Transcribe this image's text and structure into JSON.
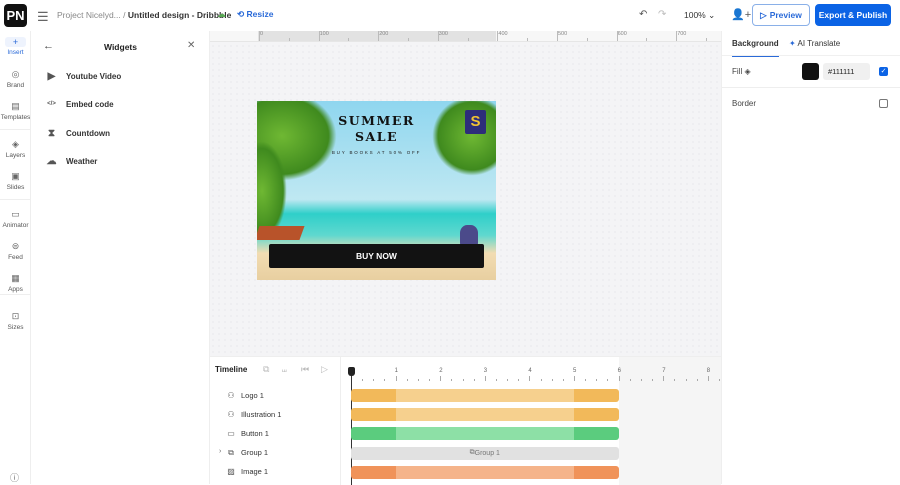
{
  "header": {
    "logo": "PN",
    "project": "Project Nicelyd...",
    "separator": "/",
    "design_name": "Untitled design - Dribbble",
    "resize_label": "Resize",
    "zoom": "100%",
    "preview_label": "Preview",
    "export_label": "Export & Publish"
  },
  "rail": [
    {
      "label": "Insert",
      "icon": "plus-icon"
    },
    {
      "label": "Brand",
      "icon": "brand-icon"
    },
    {
      "label": "Templates",
      "icon": "templates-icon"
    },
    {
      "label": "Layers",
      "icon": "layers-icon"
    },
    {
      "label": "Slides",
      "icon": "slides-icon"
    },
    {
      "label": "Animator",
      "icon": "animator-icon"
    },
    {
      "label": "Feed",
      "icon": "feed-icon"
    },
    {
      "label": "Apps",
      "icon": "apps-icon"
    },
    {
      "label": "Sizes",
      "icon": "sizes-icon"
    }
  ],
  "widgets": {
    "title": "Widgets",
    "items": [
      {
        "label": "Youtube Video",
        "icon": "video-icon"
      },
      {
        "label": "Embed code",
        "icon": "code-icon"
      },
      {
        "label": "Countdown",
        "icon": "hourglass-icon"
      },
      {
        "label": "Weather",
        "icon": "weather-icon"
      }
    ]
  },
  "ruler": {
    "labels": [
      "0",
      "100",
      "200",
      "300",
      "400",
      "500",
      "600",
      "700"
    ]
  },
  "design": {
    "title1": "SUMMER",
    "title2": "SALE",
    "subtitle": "BUY BOOKS AT 50% OFF",
    "button": "BUY NOW",
    "bag_letter": "S"
  },
  "timeline": {
    "title": "Timeline",
    "seconds": [
      "1",
      "2",
      "3",
      "4",
      "5",
      "6",
      "7",
      "8"
    ],
    "duration": 6,
    "in_end": 1,
    "out_start": 5,
    "rows": [
      {
        "name": "Logo 1",
        "icon": "logo-icon",
        "color": "#f2b95a",
        "light": "#f6d08e"
      },
      {
        "name": "Illustration 1",
        "icon": "illustration-icon",
        "color": "#f2b95a",
        "light": "#f6d08e"
      },
      {
        "name": "Button 1",
        "icon": "button-icon",
        "color": "#5bcc7e",
        "light": "#8de0a6"
      },
      {
        "name": "Group 1",
        "icon": "group-icon",
        "group": true
      },
      {
        "name": "Image 1",
        "icon": "image-icon",
        "color": "#f0935a",
        "light": "#f5b48a"
      }
    ]
  },
  "rpanel": {
    "tab_background": "Background",
    "tab_translate": "AI Translate",
    "fill_label": "Fill",
    "fill_hex": "#111111",
    "fill_color": "#111111",
    "fill_checked": true,
    "border_label": "Border",
    "border_checked": false
  },
  "colors": {
    "accent": "#0b63e5"
  }
}
